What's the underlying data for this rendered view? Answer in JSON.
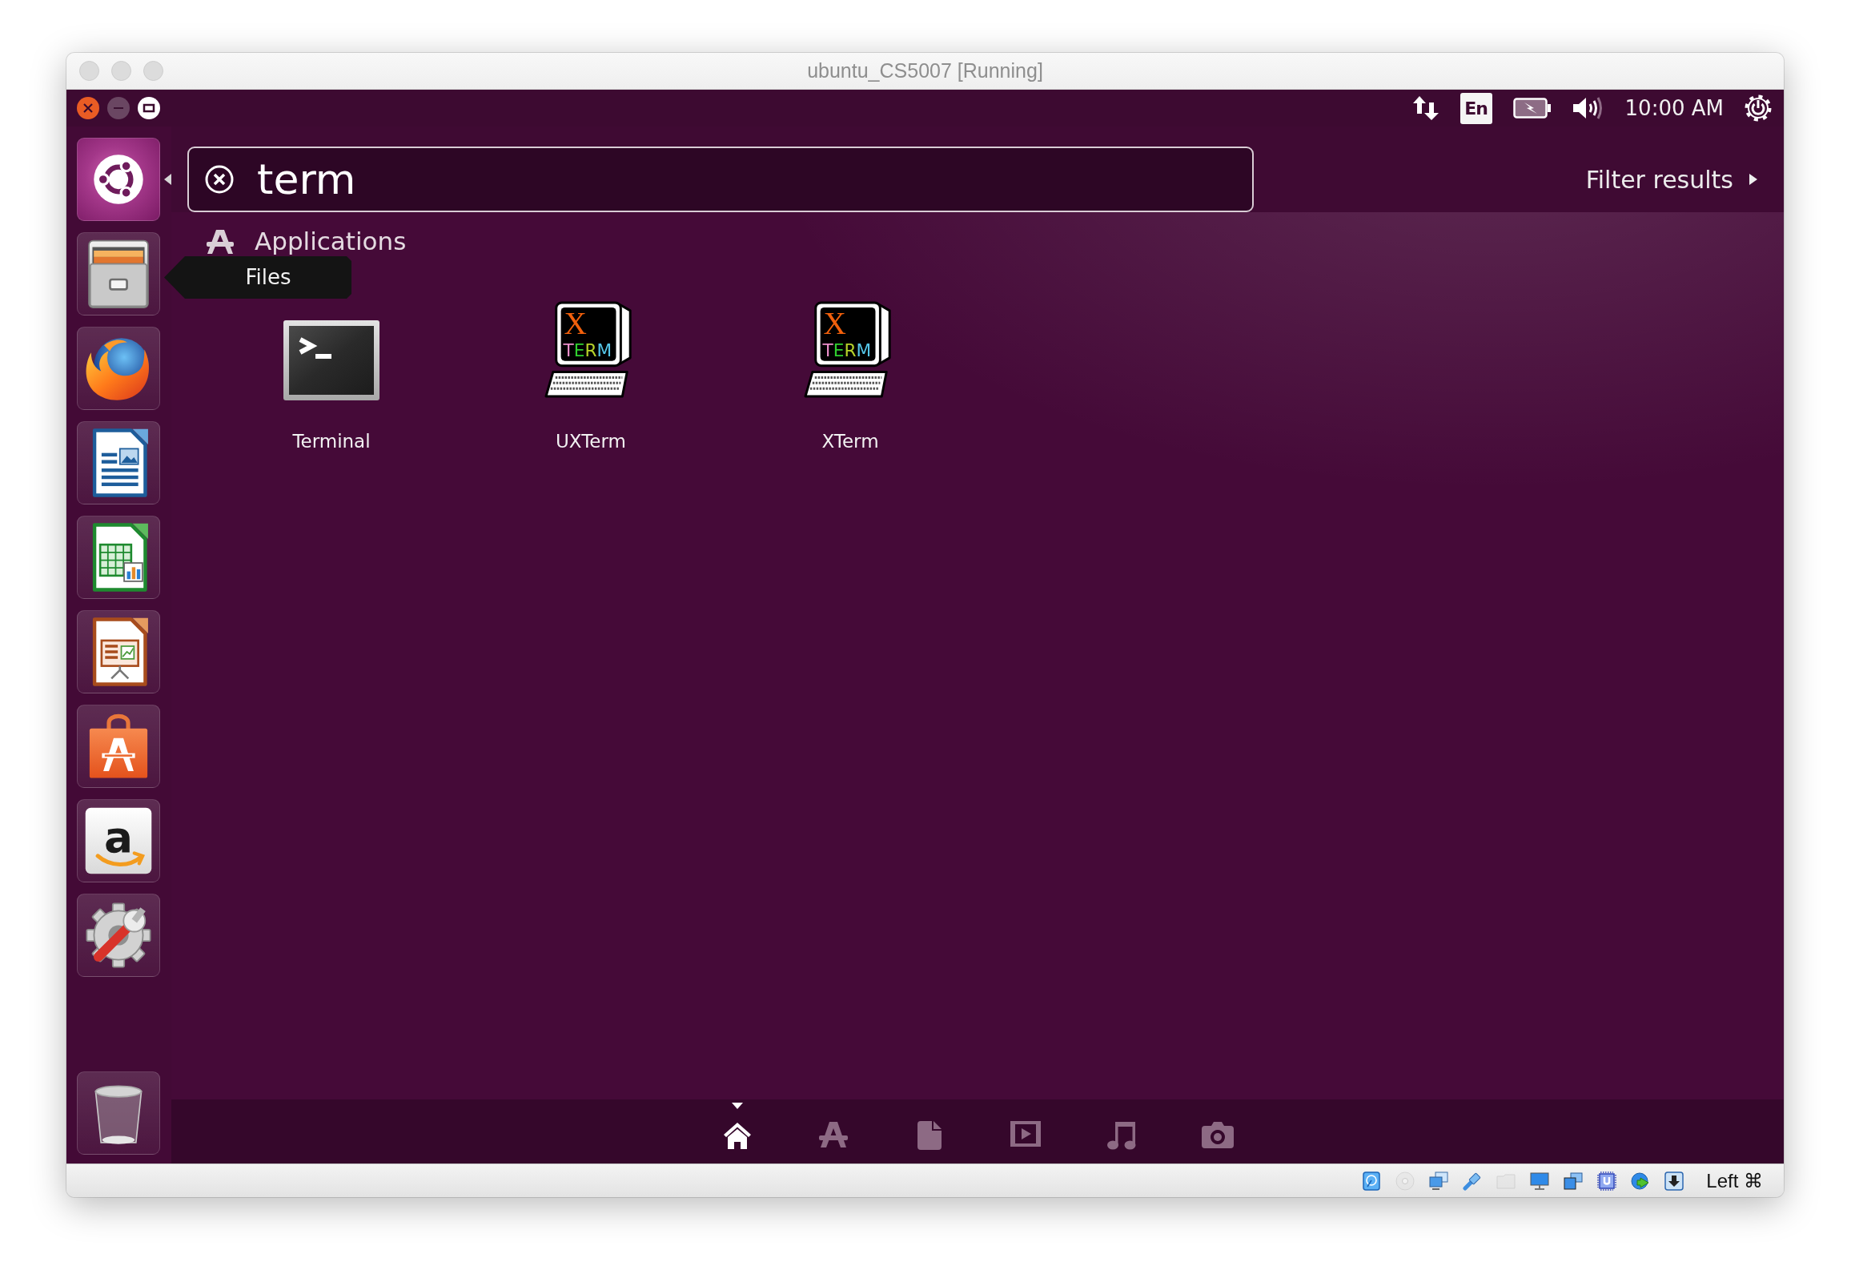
{
  "window": {
    "title": "ubuntu_CS5007 [Running]"
  },
  "panel": {
    "keyboard_layout": "En",
    "clock": "10:00 AM"
  },
  "launcher": {
    "items": [
      {
        "kind": "dash",
        "active": true
      },
      {
        "kind": "files",
        "active": false,
        "tooltip": "Files"
      },
      {
        "kind": "browser",
        "active": false
      },
      {
        "kind": "writer",
        "active": false
      },
      {
        "kind": "calc",
        "active": false
      },
      {
        "kind": "impress",
        "active": false
      },
      {
        "kind": "software",
        "active": false
      },
      {
        "kind": "amazon",
        "active": false,
        "glyph": "a"
      },
      {
        "kind": "settings",
        "active": false
      },
      {
        "kind": "trash",
        "active": false
      }
    ]
  },
  "search": {
    "value": "term"
  },
  "filter": {
    "label": "Filter results"
  },
  "category": {
    "title": "Applications"
  },
  "results": [
    {
      "kind": "terminal",
      "label": "Terminal"
    },
    {
      "kind": "xterm",
      "label": "UXTerm",
      "screen_text": [
        "X",
        "TERM"
      ]
    },
    {
      "kind": "xterm",
      "label": "XTerm",
      "screen_text": [
        "X",
        "TERM"
      ]
    }
  ],
  "lenses": [
    {
      "kind": "home",
      "selected": true
    },
    {
      "kind": "applications",
      "selected": false
    },
    {
      "kind": "files",
      "selected": false
    },
    {
      "kind": "video",
      "selected": false
    },
    {
      "kind": "music",
      "selected": false
    },
    {
      "kind": "photos",
      "selected": false
    }
  ],
  "status_bar": {
    "devices": [
      {
        "kind": "hard_disk",
        "disabled": false
      },
      {
        "kind": "optical_drive",
        "disabled": true
      },
      {
        "kind": "network",
        "disabled": false
      },
      {
        "kind": "usb",
        "disabled": false
      },
      {
        "kind": "shared_folders",
        "disabled": true
      },
      {
        "kind": "display",
        "disabled": false
      },
      {
        "kind": "recording",
        "disabled": false
      },
      {
        "kind": "cpu",
        "disabled": false
      },
      {
        "kind": "mouse_integration",
        "disabled": false
      },
      {
        "kind": "keyboard",
        "disabled": false
      }
    ],
    "host_key": "Left ⌘"
  }
}
